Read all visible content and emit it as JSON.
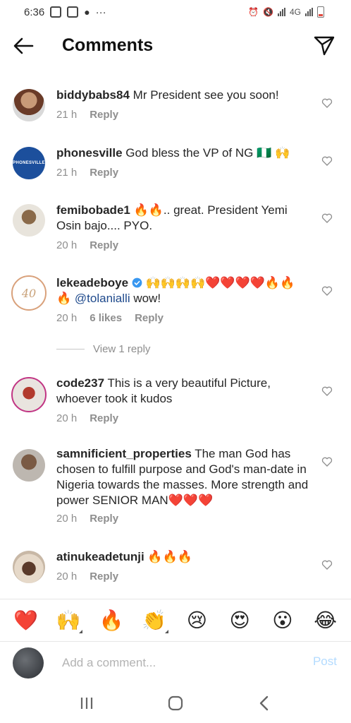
{
  "status_bar": {
    "time": "6:36",
    "more": "···",
    "network": "4G"
  },
  "header": {
    "title": "Comments"
  },
  "comments": [
    {
      "username": "biddybabs84",
      "text": "Mr President see you soon!",
      "time": "21 h",
      "reply": "Reply"
    },
    {
      "username": "phonesville",
      "text": "God bless the VP of NG 🇳🇬 🙌",
      "time": "21 h",
      "reply": "Reply",
      "avatar_text": "PHONESVILLE"
    },
    {
      "username": "femibobade1",
      "text": "🔥🔥.. great. President Yemi Osin bajo.... PYO.",
      "time": "20 h",
      "reply": "Reply"
    },
    {
      "username": "lekeadeboye",
      "text_before": "🙌🙌🙌🙌❤️❤️❤️❤️🔥🔥 🔥",
      "mention": "@tolanialli",
      "text_after": "wow!",
      "time": "20 h",
      "likes": "6 likes",
      "reply": "Reply",
      "avatar_text": "40"
    },
    {
      "username": "code237",
      "text": "This is a very beautiful Picture, whoever took it kudos",
      "time": "20 h",
      "reply": "Reply"
    },
    {
      "username": "samnificient_properties",
      "text": "The man God has chosen to fulfill purpose and God's man-date in Nigeria towards the masses. More strength and power SENIOR MAN❤️❤️❤️",
      "time": "20 h",
      "reply": "Reply"
    },
    {
      "username": "atinukeadetunji",
      "text": "🔥🔥🔥",
      "time": "20 h",
      "reply": "Reply"
    }
  ],
  "view_replies": "View 1 reply",
  "emoji_bar": [
    "❤️",
    "🙌",
    "🔥",
    "👏",
    "😢",
    "😍",
    "😮",
    "😂"
  ],
  "input": {
    "placeholder": "Add a comment...",
    "post_label": "Post"
  },
  "colors": {
    "mention": "#1f4a8c",
    "post_disabled": "#b3dbff",
    "meta": "#8e8e8e"
  }
}
